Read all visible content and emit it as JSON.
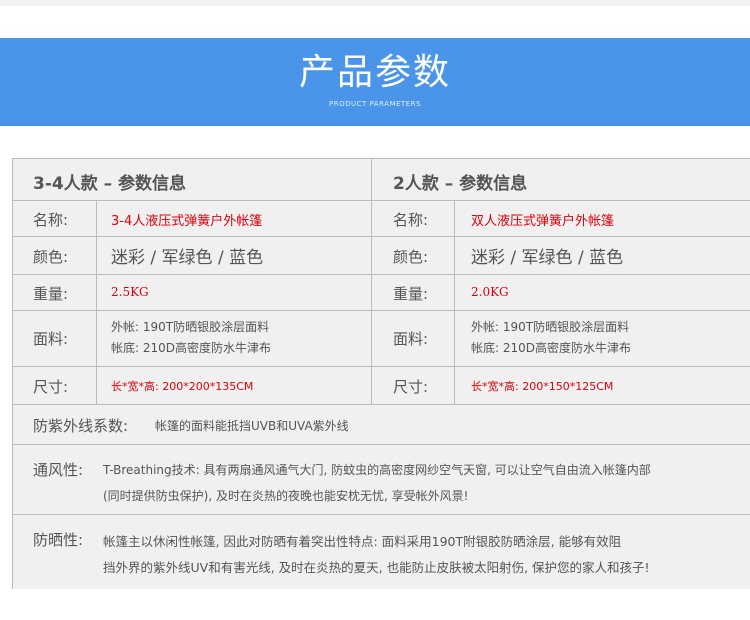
{
  "banner": {
    "title": "产品参数",
    "subtitle": "PRODUCT PARAMETERS"
  },
  "columns": [
    {
      "header": "3-4人款 – 参数信息",
      "name_label": "名称:",
      "name_value": "3-4人液压式弹簧户外帐篷",
      "color_label": "颜色:",
      "color_value": "迷彩 / 军绿色 / 蓝色",
      "weight_label": "重量:",
      "weight_value": "2.5KG",
      "fabric_label": "面料:",
      "fabric_line1": "外帐: 190T防晒银胶涂层面料",
      "fabric_line2": "帐底: 210D高密度防水牛津布",
      "size_label": "尺寸:",
      "size_value": "长*宽*高: 200*200*135CM"
    },
    {
      "header": "2人款 – 参数信息",
      "name_label": "名称:",
      "name_value": "双人液压式弹簧户外帐篷",
      "color_label": "颜色:",
      "color_value": "迷彩 / 军绿色 / 蓝色",
      "weight_label": "重量:",
      "weight_value": "2.0KG",
      "fabric_label": "面料:",
      "fabric_line1": "外帐: 190T防晒银胶涂层面料",
      "fabric_line2": "帐底: 210D高密度防水牛津布",
      "size_label": "尺寸:",
      "size_value": "长*宽*高: 200*150*125CM"
    }
  ],
  "uv": {
    "label": "防紫外线系数:",
    "text": "帐篷的面料能抵挡UVB和UVA紫外线"
  },
  "ventilation": {
    "label": "通风性:",
    "line1": "T-Breathing技术: 具有两扇通风通气大门, 防蚊虫的高密度网纱空气天窗, 可以让空气自由流入帐篷内部",
    "line2": "(同时提供防虫保护), 及时在炎热的夜晚也能安枕无忧, 享受帐外风景!"
  },
  "sunproof": {
    "label": "防晒性:",
    "line1": "帐篷主以休闲性帐篷, 因此对防晒有着突出性特点: 面料采用190T附银胶防晒涂层, 能够有效阻",
    "line2": "挡外界的紫外线UV和有害光线, 及时在炎热的夏天, 也能防止皮肤被太阳射伤, 保护您的家人和孩子!"
  },
  "colors": {
    "banner": "#4a95ea",
    "accent_red": "#e1000a",
    "table_bg": "#f0f0f0",
    "border": "#bbbbbb"
  }
}
